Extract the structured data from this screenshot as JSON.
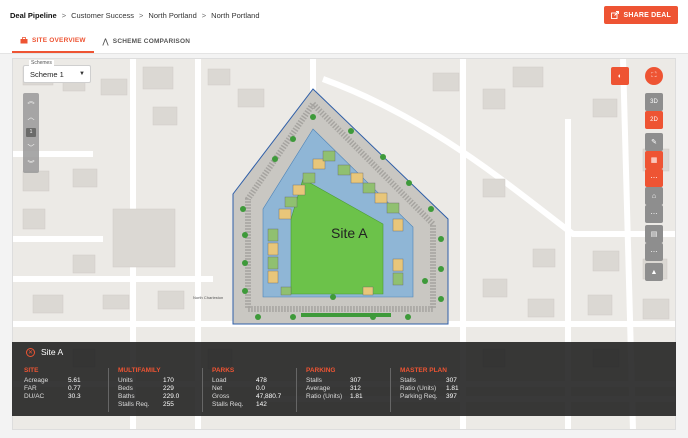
{
  "breadcrumb": {
    "items": [
      "Deal Pipeline",
      "Customer Success",
      "North Portland",
      "North Portland"
    ]
  },
  "share_label": "SHARE DEAL",
  "tabs": [
    {
      "label": "SITE OVERVIEW"
    },
    {
      "label": "SCHEME COMPARISON"
    }
  ],
  "scheme": {
    "label": "Schemes",
    "value": "Scheme 1"
  },
  "level": "1",
  "view": {
    "3d": "3D",
    "2d": "2D"
  },
  "map": {
    "site_label": "Site A"
  },
  "panel": {
    "title": "Site A",
    "site": {
      "heading": "SITE",
      "rows": [
        [
          "Acreage",
          "5.61"
        ],
        [
          "FAR",
          "0.77"
        ],
        [
          "DU/AC",
          "30.3"
        ]
      ]
    },
    "multifamily": {
      "heading": "MULTIFAMILY",
      "rows": [
        [
          "Units",
          "170"
        ],
        [
          "Beds",
          "229"
        ],
        [
          "Baths",
          "229.0"
        ],
        [
          "Stalls Req.",
          "255"
        ]
      ]
    },
    "parks": {
      "heading": "PARKS",
      "rows": [
        [
          "Load",
          "478"
        ],
        [
          "Net",
          "0.0"
        ],
        [
          "Gross",
          "47,880.7"
        ],
        [
          "Stalls Req.",
          "142"
        ]
      ]
    },
    "parking": {
      "heading": "PARKING",
      "rows": [
        [
          "Stalls",
          "307"
        ],
        [
          "Average",
          "312"
        ],
        [
          "Ratio (Units)",
          "1.81"
        ]
      ]
    },
    "masterplan": {
      "heading": "MASTER PLAN",
      "rows": [
        [
          "Stalls",
          "307"
        ],
        [
          "Ratio (Units)",
          "1.81"
        ],
        [
          "Parking Req.",
          "397"
        ]
      ]
    }
  }
}
